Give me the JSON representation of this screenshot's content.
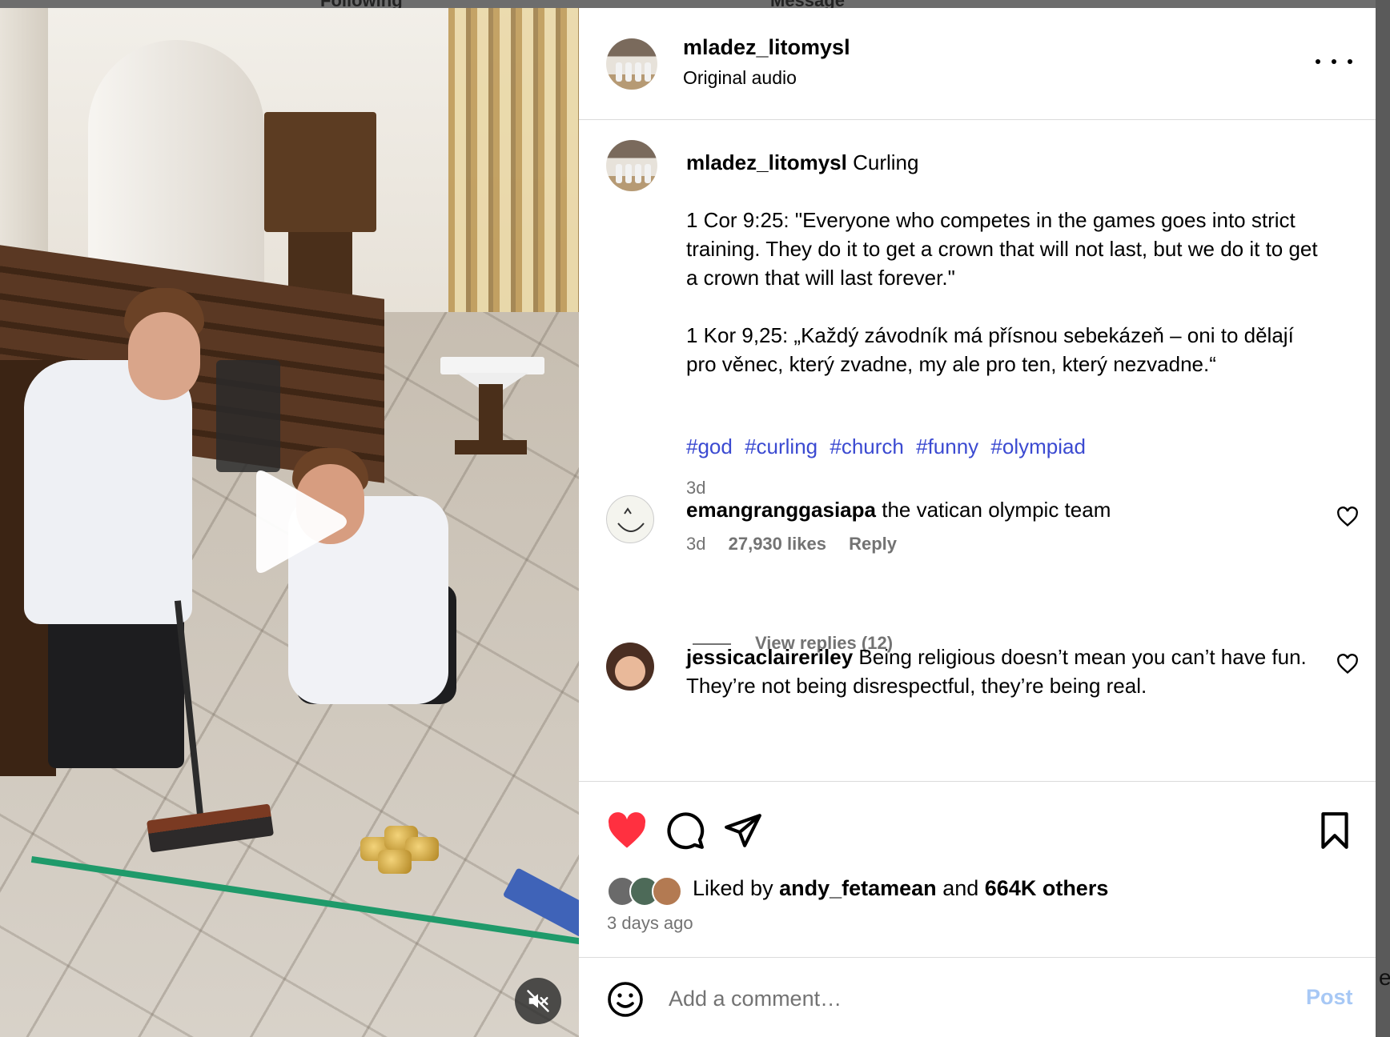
{
  "background": {
    "nav": [
      "Following",
      "Message"
    ]
  },
  "video": {
    "play_icon": "play-icon",
    "mute_icon": "speaker-muted-icon"
  },
  "header": {
    "username": "mladez_litomysl",
    "subtitle": "Original audio",
    "more_icon": "more-horizontal-icon"
  },
  "caption": {
    "username": "mladez_litomysl",
    "title": "Curling",
    "paragraph1": "1 Cor 9:25: \"Everyone who competes in the games goes into strict training. They do it to get a crown that will not last, but we do it to get a crown that will last forever.\"",
    "paragraph2": "1 Kor 9,25: „Každý závodník má přísnou sebekázeň – oni to dělají pro věnec, který zvadne, my ale pro ten, který nezvadne.“",
    "hashtags": [
      "#god",
      "#curling",
      "#church",
      "#funny",
      "#olympiad"
    ],
    "time": "3d"
  },
  "comments": [
    {
      "username": "emangranggasiapa",
      "text": "the vatican olympic team",
      "time": "3d",
      "likes": "27,930 likes",
      "reply": "Reply",
      "view_replies": "View replies (12)"
    },
    {
      "username": "jessicaclaireriley",
      "text": "Being religious doesn’t mean you can’t have fun. They’re not being disrespectful, they’re being real."
    }
  ],
  "actions": {
    "liked_state": true,
    "like_color": "#ff3040",
    "liked_prefix": "Liked by",
    "liked_user": "andy_fetamean",
    "liked_and": "and",
    "liked_others": "664K others",
    "posted": "3 days ago"
  },
  "comment_box": {
    "placeholder": "Add a comment…",
    "post_label": "Post",
    "post_color": "#a7c8f5"
  }
}
